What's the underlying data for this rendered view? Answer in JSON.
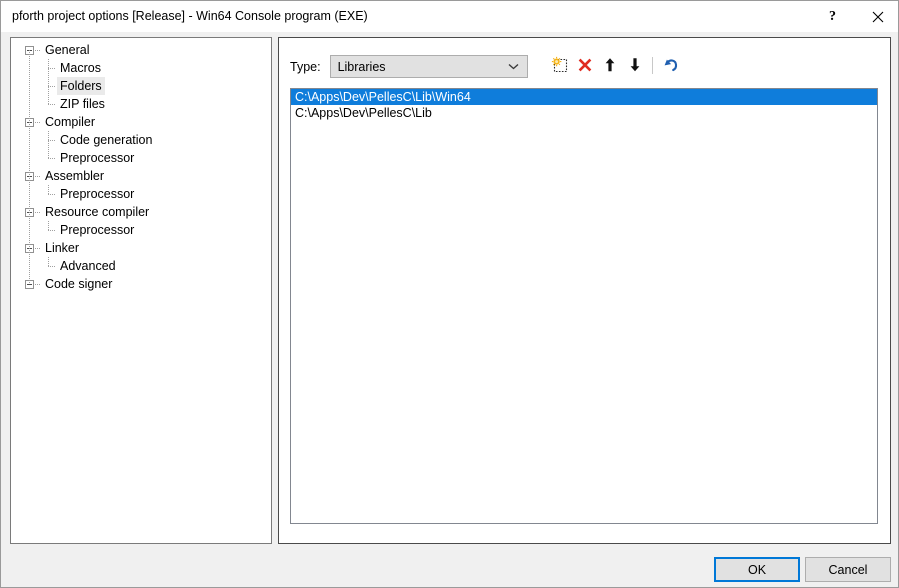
{
  "window": {
    "title": "pforth project options [Release] - Win64 Console program (EXE)",
    "help_icon": "question-mark-icon",
    "close_icon": "close-icon"
  },
  "tree": {
    "items": [
      {
        "label": "General",
        "level": 0,
        "expanded": true,
        "selected": false
      },
      {
        "label": "Macros",
        "level": 1,
        "expanded": false,
        "selected": false
      },
      {
        "label": "Folders",
        "level": 1,
        "expanded": false,
        "selected": true
      },
      {
        "label": "ZIP files",
        "level": 1,
        "expanded": false,
        "selected": false
      },
      {
        "label": "Compiler",
        "level": 0,
        "expanded": true,
        "selected": false
      },
      {
        "label": "Code generation",
        "level": 1,
        "expanded": false,
        "selected": false
      },
      {
        "label": "Preprocessor",
        "level": 1,
        "expanded": false,
        "selected": false
      },
      {
        "label": "Assembler",
        "level": 0,
        "expanded": true,
        "selected": false
      },
      {
        "label": "Preprocessor",
        "level": 1,
        "expanded": false,
        "selected": false
      },
      {
        "label": "Resource compiler",
        "level": 0,
        "expanded": true,
        "selected": false
      },
      {
        "label": "Preprocessor",
        "level": 1,
        "expanded": false,
        "selected": false
      },
      {
        "label": "Linker",
        "level": 0,
        "expanded": true,
        "selected": false
      },
      {
        "label": "Advanced",
        "level": 1,
        "expanded": false,
        "selected": false
      },
      {
        "label": "Code signer",
        "level": 0,
        "expanded": false,
        "selected": false
      }
    ]
  },
  "folders_page": {
    "type_label": "Type:",
    "type_value": "Libraries",
    "type_options": [
      "Libraries"
    ],
    "toolbar": [
      {
        "name": "new-item-icon",
        "title": "New"
      },
      {
        "name": "delete-item-icon",
        "title": "Delete"
      },
      {
        "name": "move-up-icon",
        "title": "Move up"
      },
      {
        "name": "move-down-icon",
        "title": "Move down"
      },
      {
        "name": "undo-icon",
        "title": "Undo"
      }
    ],
    "paths": [
      {
        "value": "C:\\Apps\\Dev\\PellesC\\Lib\\Win64",
        "selected": true
      },
      {
        "value": "C:\\Apps\\Dev\\PellesC\\Lib",
        "selected": false
      }
    ]
  },
  "footer": {
    "ok_label": "OK",
    "cancel_label": "Cancel"
  },
  "colors": {
    "selection_blue": "#0f7ddb",
    "focus_blue": "#0078d7",
    "delete_red": "#e02b20",
    "undo_blue": "#1f5fb0",
    "dialog_bg": "#f0f0f0"
  }
}
